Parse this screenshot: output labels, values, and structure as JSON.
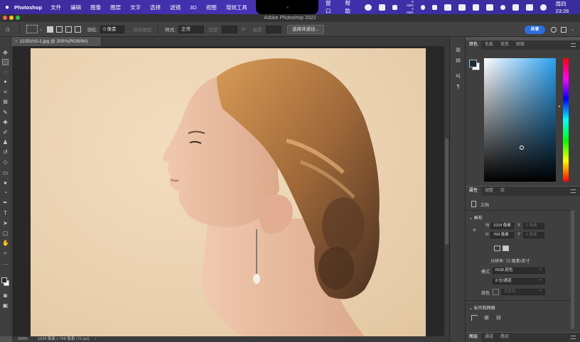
{
  "menubar": {
    "app": "Photoshop",
    "items": [
      "文件",
      "编辑",
      "图像",
      "图层",
      "文字",
      "选择",
      "滤镜",
      "3D",
      "视图",
      "增效工具"
    ],
    "right_items": [
      "窗口",
      "帮助"
    ],
    "net_up": "0 KB/s",
    "net_down": "0 KB/s",
    "clock": "周四 23:28"
  },
  "window": {
    "title": "Adobe Photoshop 2022"
  },
  "options": {
    "feather_label": "羽化:",
    "feather_value": "0 像素",
    "antialias_label": "消除锯齿",
    "style_label": "样式:",
    "style_value": "正常",
    "width_label": "宽度:",
    "height_label": "高度:",
    "select_mask_button": "选择并遮住...",
    "share_button": "共享"
  },
  "document": {
    "tab_title": "1105Vc5-1.jpg @ 200%(RGB/8#)",
    "status_zoom": "200%",
    "status_info": "1024 像素 x 768 像素 (72 ppi)"
  },
  "color_panel": {
    "tabs": [
      "颜色",
      "色板",
      "渐变",
      "图案"
    ],
    "active_tab": 0,
    "foreground": "#1c2a38",
    "background": "#ffffff"
  },
  "properties_panel": {
    "tabs": [
      "属性",
      "调整",
      "库"
    ],
    "active_tab": 0,
    "doc_label": "文档",
    "canvas_section": "画布",
    "w_label": "W",
    "w_value": "1024 像素",
    "x_label": "X",
    "x_value": "0 像素",
    "h_label": "H",
    "h_value": "768 像素",
    "y_label": "Y",
    "y_value": "0 像素",
    "resolution": "分辨率: 72 像素/英寸",
    "mode_label": "模式",
    "mode_value": "RGB 颜色",
    "depth_value": "8 位/通道",
    "fill_label": "填色",
    "fill_value": "背景色",
    "rulers_section": "标尺和网格"
  },
  "layers_panel": {
    "tabs": [
      "图层",
      "通道",
      "路径"
    ],
    "active_tab": 0
  }
}
